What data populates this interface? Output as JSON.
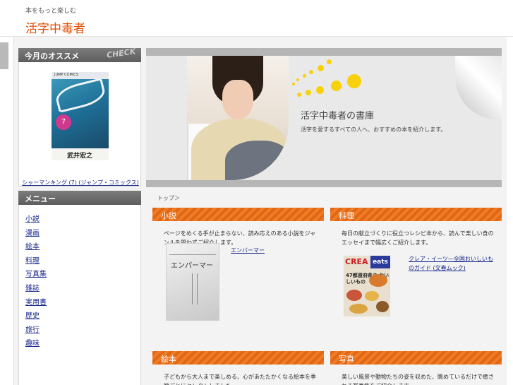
{
  "header": {
    "tagline": "本をもっと楽しむ",
    "site_title": "活字中毒者"
  },
  "sidebar": {
    "recommend_title": "今月のオススメ",
    "recommend_check": "CHECK",
    "recommend_cover": {
      "label": "JUMP COMICS",
      "volume": "7",
      "author": "武井宏之"
    },
    "recommend_link": "シャーマンキング (7) (ジャンプ・コミックス)",
    "menu_title": "メニュー",
    "menu_items": [
      "小説",
      "漫画",
      "絵本",
      "料理",
      "写真集",
      "雑誌",
      "実用書",
      "歴史",
      "旅行",
      "趣味"
    ]
  },
  "hero": {
    "title": "活字中毒者の書庫",
    "description": "活字を愛するすべての人へ、おすすめの本を紹介します。"
  },
  "breadcrumb": "トップ＞",
  "sections": [
    {
      "title": "小説",
      "description": "ページをめくる手が止まらない、読み応えのある小説をジャンルを問わずご紹介します。",
      "book_title": "エンパーマー",
      "link": "エンバーマー"
    },
    {
      "title": "料理",
      "description": "毎日の献立づくりに役立つレシピ本から、読んで楽しい食のエッセイまで幅広くご紹介します。",
      "cover_logo": "CREA",
      "cover_badge": "eats",
      "cover_text": "47都道府県の おいしいもの",
      "link": "クレア・イーツ—全国おいしいものガイド (文春ムック)"
    },
    {
      "title": "絵本",
      "description": "子どもから大人まで楽しめる、心があたたかくなる絵本を季節ごとにセレクトしました。"
    },
    {
      "title": "写真",
      "description": "美しい風景や動物たちの姿を収めた、眺めているだけで癒される写真集をご紹介します。"
    }
  ]
}
